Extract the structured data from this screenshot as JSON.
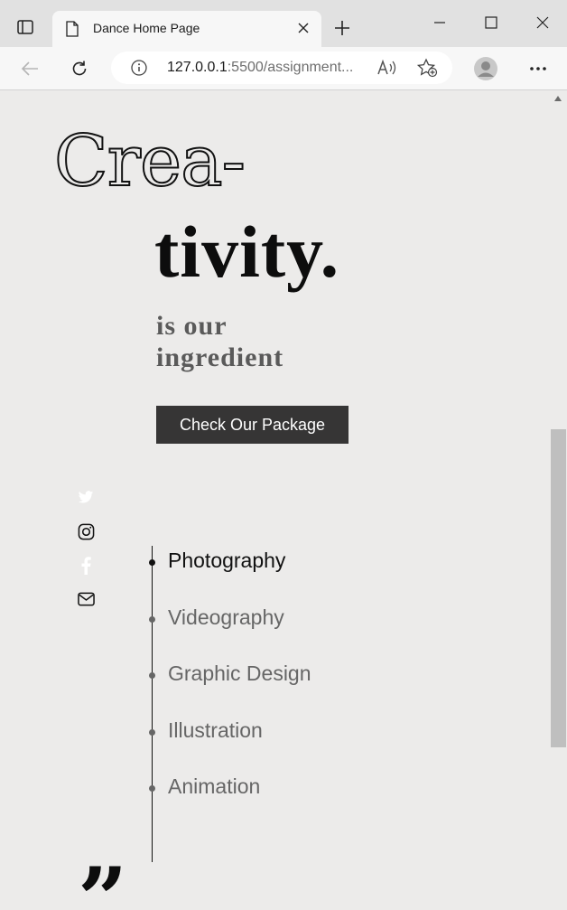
{
  "browser": {
    "tab_title": "Dance Home Page",
    "url_host": "127.0.0.1",
    "url_rest": ":5500/assignment..."
  },
  "hero": {
    "line1": "Crea-",
    "line2": "tivity.",
    "tagline_1": "is our",
    "tagline_2": "ingredient",
    "cta_label": "Check Our Package"
  },
  "social": [
    "twitter-icon",
    "instagram-icon",
    "facebook-icon",
    "mail-icon"
  ],
  "services": [
    {
      "label": "Photography",
      "active": true
    },
    {
      "label": "Videography",
      "active": false
    },
    {
      "label": "Graphic Design",
      "active": false
    },
    {
      "label": "Illustration",
      "active": false
    },
    {
      "label": "Animation",
      "active": false
    }
  ],
  "quote_mark": "”",
  "colors": {
    "page_bg": "#ecebea",
    "button_bg": "#363535",
    "text_dark": "#111111",
    "text_muted": "#666666"
  }
}
